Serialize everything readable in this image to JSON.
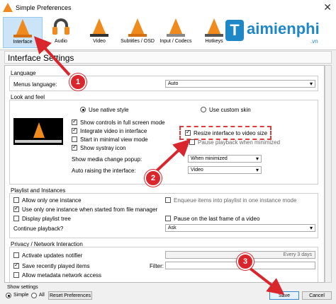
{
  "window": {
    "title": "Simple Preferences",
    "close": "✕"
  },
  "toolbar": {
    "items": [
      {
        "label": "Interface",
        "icon": "interface-cone-icon"
      },
      {
        "label": "Audio",
        "icon": "headphones-icon"
      },
      {
        "label": "Video",
        "icon": "video-cone-icon"
      },
      {
        "label": "Subtitles / OSD",
        "icon": "subtitles-cone-icon"
      },
      {
        "label": "Input / Codecs",
        "icon": "codecs-cone-icon"
      },
      {
        "label": "Hotkeys",
        "icon": "hotkeys-cone-icon"
      }
    ]
  },
  "brand": {
    "letter": "T",
    "name": "aimienphi",
    "suffix": ".vn"
  },
  "section_title": "Interface Settings",
  "language": {
    "title": "Language",
    "menus_label": "Menus language:",
    "menus_value": "Auto"
  },
  "look": {
    "title": "Look and feel",
    "native": "Use native style",
    "custom": "Use custom skin",
    "fullscreen_controls": "Show controls in full screen mode",
    "integrate_video": "Integrate video in interface",
    "minimal_view": "Start in minimal view mode",
    "systray": "Show systray icon",
    "resize": "Resize interface to video size",
    "pause_minimized": "Pause playback when minimized",
    "media_popup_label": "Show media change popup:",
    "media_popup_value": "When minimized",
    "auto_raise_label": "Auto raising the interface:",
    "auto_raise_value": "Video"
  },
  "playlist": {
    "title": "Playlist and Instances",
    "one_instance": "Allow only one instance",
    "enqueue": "Enqueue items into playlist in one instance mode",
    "file_manager": "Use only one instance when started from file manager",
    "display_tree": "Display playlist tree",
    "pause_last": "Pause on the last frame of a video",
    "continue_label": "Continue playback?",
    "continue_value": "Ask"
  },
  "privacy": {
    "title": "Privacy / Network Interaction",
    "updates": "Activate updates notifier",
    "updates_value": "Every 3 days",
    "recent": "Save recently played items",
    "filter_label": "Filter:",
    "metadata": "Allow metadata network access"
  },
  "footer": {
    "show_settings": "Show settings",
    "simple": "Simple",
    "all": "All",
    "reset": "Reset Preferences",
    "save": "Save",
    "cancel": "Cancel"
  },
  "annotations": {
    "step1": "1",
    "step2": "2",
    "step3": "3"
  },
  "colors": {
    "accent": "#f08a1c",
    "callout": "#d8262c",
    "brand": "#1e87c8"
  }
}
